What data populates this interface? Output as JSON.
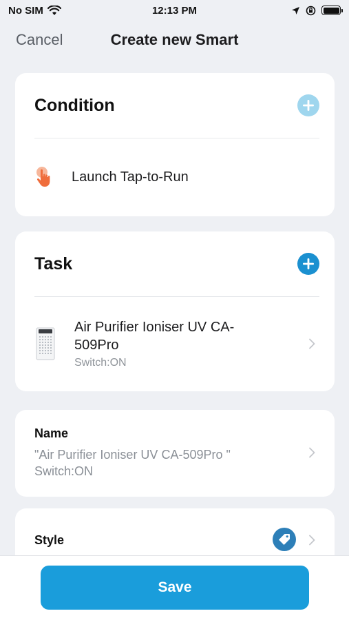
{
  "status_bar": {
    "carrier": "No SIM",
    "time": "12:13 PM"
  },
  "nav": {
    "cancel_label": "Cancel",
    "title": "Create new Smart"
  },
  "condition": {
    "title": "Condition",
    "add_icon": "plus-circle-icon",
    "add_color": "#9fd6ee",
    "items": [
      {
        "label": "Launch Tap-to-Run",
        "icon": "tap-hand-icon",
        "icon_color": "#ef6d3c"
      }
    ]
  },
  "task": {
    "title": "Task",
    "add_icon": "plus-circle-icon",
    "add_color": "#1b90d0",
    "items": [
      {
        "name": "Air Purifier Ioniser UV CA-509Pro",
        "status": "Switch:ON",
        "icon": "air-purifier-icon"
      }
    ]
  },
  "name_field": {
    "label": "Name",
    "value": "\"Air Purifier Ioniser UV CA-509Pro \" Switch:ON"
  },
  "style_field": {
    "label": "Style",
    "icon": "tag-icon",
    "icon_color": "#2d7fb8"
  },
  "save_label": "Save",
  "accent_color": "#1a9ddb"
}
